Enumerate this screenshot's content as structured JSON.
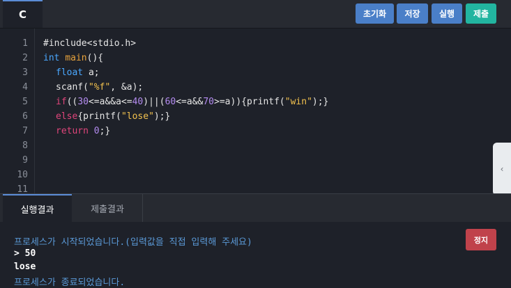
{
  "header": {
    "language_tab": "C",
    "buttons": {
      "reset": "초기화",
      "save": "저장",
      "run": "실행",
      "submit": "제출"
    }
  },
  "editor": {
    "line_numbers": [
      "1",
      "2",
      "3",
      "4",
      "5",
      "6",
      "7",
      "8",
      "9",
      "10",
      "11"
    ],
    "code": {
      "l1_include": "#include<stdio.h>",
      "l2_int": "int",
      "l2_main": "main",
      "l2_rest": "(){",
      "l3_float": "float",
      "l3_rest": " a;",
      "l4_fn": "scanf(",
      "l4_str": "\"%f\"",
      "l4_rest": ", &a);",
      "l5_if": "if",
      "l5_p1": "((",
      "l5_n30": "30",
      "l5_p2": "<=a&&a<=",
      "l5_n40": "40",
      "l5_p3": ")||(",
      "l5_n60": "60",
      "l5_p4": "<=a&&",
      "l5_n70": "70",
      "l5_p5": ">=a)){printf(",
      "l5_str": "\"win\"",
      "l5_p6": ");}",
      "l6_else": "else",
      "l6_p1": "{printf(",
      "l6_str": "\"lose\"",
      "l6_p2": ");}",
      "l7_return": "return",
      "l7_n0": "0",
      "l7_p1": ";}"
    },
    "side_toggle_icon": "chevron-left-icon"
  },
  "bottom_panel": {
    "tabs": {
      "run_result": "실행결과",
      "submit_result": "제출결과"
    },
    "console": {
      "line1": "프로세스가 시작되었습니다.(입력값을 직접 입력해 주세요)",
      "line2": "> 50",
      "line3": "lose",
      "line4": "프로세스가 종료되었습니다."
    },
    "stop_button": "정지"
  },
  "colors": {
    "run_button": "#4a7fc8",
    "submit_button": "#22b5a0",
    "stop_button": "#c0424b",
    "console_info_text": "#5b9ad8"
  }
}
